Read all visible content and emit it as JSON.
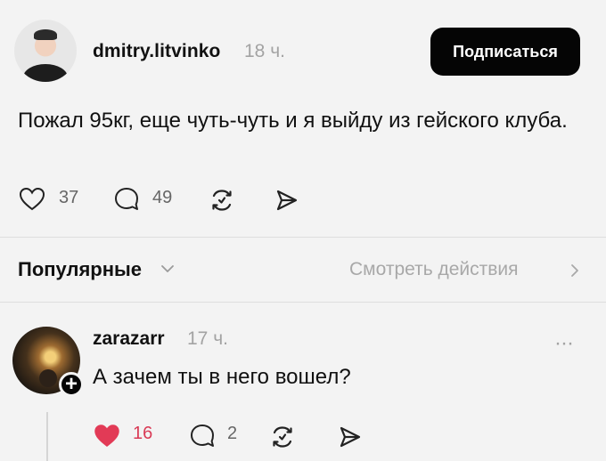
{
  "post": {
    "username": "dmitry.litvinko",
    "time": "18 ч.",
    "follow_label": "Подписаться",
    "text": "Пожал 95кг, еще чуть-чуть и я выйду из гейского клуба.",
    "likes": "37",
    "comments": "49"
  },
  "section": {
    "popular_label": "Популярные",
    "activity_label": "Смотреть действия"
  },
  "comment": {
    "username": "zarazarr",
    "time": "17 ч.",
    "text": "А зачем ты в него вошел?",
    "likes": "16",
    "comments": "2",
    "menu": "···",
    "add": "+"
  },
  "icons": {
    "like": "heart-icon",
    "comment": "comment-bubble-icon",
    "repost": "repost-icon",
    "share": "send-icon",
    "chevron_down": "chevron-down-icon",
    "chevron_right": "chevron-right-icon",
    "menu": "more-icon"
  },
  "colors": {
    "background": "#f3f3f3",
    "button_bg": "#050505",
    "muted_text": "#a3a3a3",
    "like_active": "#e23a56"
  }
}
